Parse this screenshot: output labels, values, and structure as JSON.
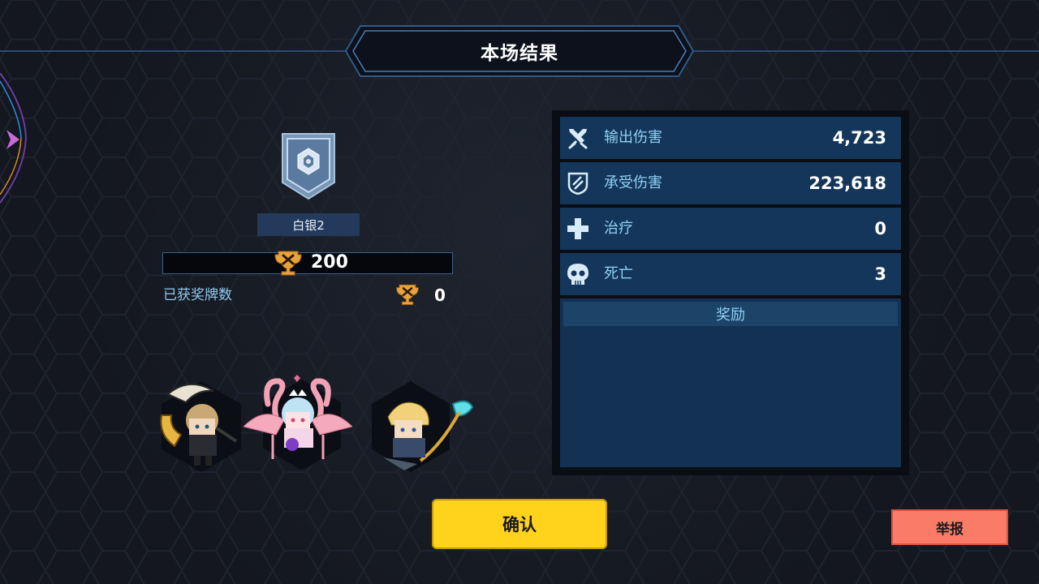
{
  "header": {
    "title": "本场结果"
  },
  "rank": {
    "tier_label": "白银2",
    "score": "200",
    "icon": "silver-rank-badge-icon"
  },
  "medals": {
    "label": "已获奖牌数",
    "value": "0",
    "icon": "trophy-icon"
  },
  "team": [
    {
      "name": "hero-1",
      "icon": "scythe-girl-portrait"
    },
    {
      "name": "hero-2",
      "icon": "flamingo-girl-portrait"
    },
    {
      "name": "hero-3",
      "icon": "blonde-knight-portrait"
    }
  ],
  "stats": [
    {
      "label": "输出伤害",
      "value": "4,723",
      "icon": "swords-icon"
    },
    {
      "label": "承受伤害",
      "value": "223,618",
      "icon": "shield-icon"
    },
    {
      "label": "治疗",
      "value": "0",
      "icon": "heal-cross-icon"
    },
    {
      "label": "死亡",
      "value": "3",
      "icon": "skull-icon"
    }
  ],
  "rewards": {
    "header": "奖励"
  },
  "buttons": {
    "confirm": "确认",
    "report": "举报"
  },
  "colors": {
    "background": "#14171f",
    "panel": "#14365a",
    "accent_text": "#8fd0f5",
    "confirm": "#ffd21c",
    "report": "#fa7b66",
    "trophy_gold": "#e8a33a"
  }
}
